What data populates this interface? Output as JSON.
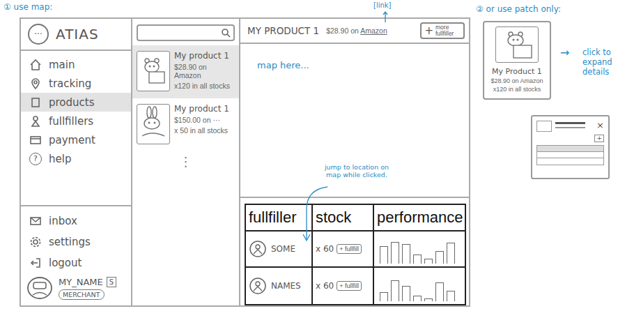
{
  "annotations": {
    "use_map": "① use map:",
    "patch_only": "② or use patch only:",
    "link": "[link]",
    "map_placeholder": "map here...",
    "jump_hint": "jump to location on map while clicked.",
    "expand_arrow": "→",
    "expand_hint": "click to expand details"
  },
  "app": {
    "logo_icon": "···",
    "logo": "ATIAS"
  },
  "sidebar": {
    "items": [
      {
        "label": "main",
        "selected": false,
        "icon_text": ""
      },
      {
        "label": "tracking",
        "selected": false,
        "icon_text": ""
      },
      {
        "label": "products",
        "selected": true,
        "icon_text": ""
      },
      {
        "label": "fullfillers",
        "selected": false,
        "icon_text": ""
      },
      {
        "label": "payment",
        "selected": false,
        "icon_text": ""
      },
      {
        "label": "help",
        "selected": false,
        "icon_text": "?"
      }
    ],
    "bottom_items": [
      {
        "label": "inbox"
      },
      {
        "label": "settings"
      },
      {
        "label": "logout"
      }
    ],
    "user": {
      "name": "MY_NAME",
      "badge": "S",
      "role": "MERCHANT"
    }
  },
  "product_list": {
    "search": {
      "placeholder": ""
    },
    "products": [
      {
        "title": "My product 1",
        "price": "$28.90 on Amazon",
        "stock": "x120 in all stocks",
        "selected": true
      },
      {
        "title": "My product 1",
        "price": "$150.00 on ···",
        "stock": "x 50 in all stocks",
        "selected": false
      }
    ],
    "more": "⋮"
  },
  "detail": {
    "title": "MY PRODUCT 1",
    "price": "$28.90 on",
    "store": "Amazon",
    "add_icon": "+",
    "add_label": "more fullfiller"
  },
  "table": {
    "columns": [
      "fullfiller",
      "stock",
      "performance"
    ],
    "rows": [
      {
        "name": "SOME",
        "stock": "x 60",
        "action": "+ fullfill",
        "performance": [
          28,
          34,
          31,
          14,
          8,
          20,
          33
        ]
      },
      {
        "name": "NAMES",
        "stock": "x 60",
        "action": "+ fullfill",
        "performance": [
          14,
          33,
          24,
          9,
          4,
          30,
          17
        ]
      }
    ]
  },
  "patch": {
    "title": "My Product 1",
    "price": "$28.90 on Amazon",
    "stock": "x120 in all stocks"
  },
  "popup": {
    "close": "×",
    "add": "+"
  }
}
